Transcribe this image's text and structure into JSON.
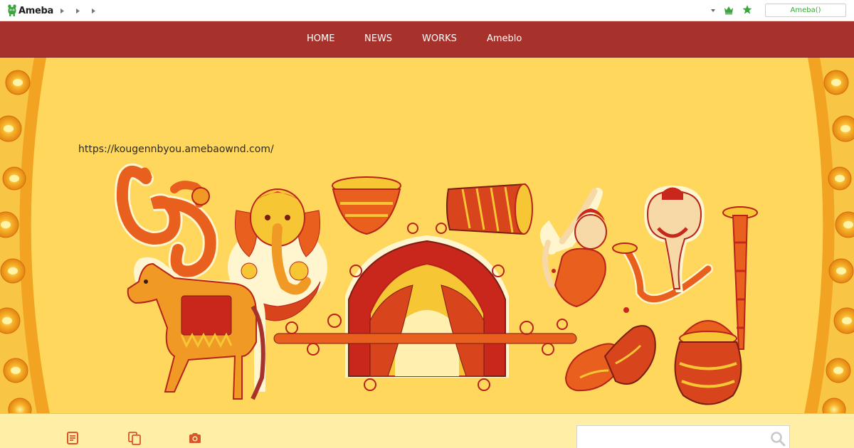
{
  "topbar": {
    "logo_text": "Ameba",
    "login_label": "Ameba()",
    "icons": [
      "ameba-mascot-icon",
      "chevron-right-icon",
      "caret-down-icon",
      "crown-icon",
      "star-icon"
    ]
  },
  "nav": {
    "items": [
      {
        "label": "HOME"
      },
      {
        "label": "NEWS"
      },
      {
        "label": "WORKS"
      },
      {
        "label": "Ameblo"
      }
    ]
  },
  "hero": {
    "url_text": "https://kougennbyou.amebaownd.com/",
    "illustration": "indian-folk-art-illustration"
  },
  "bottom": {
    "icons": [
      "document-icon",
      "pages-icon",
      "camera-icon",
      "search-icon"
    ],
    "search_value": ""
  },
  "colors": {
    "nav_bg": "#a7312b",
    "hero_bg": "#ffd75c",
    "page_bg": "#ffeea6",
    "accent_green": "#3aa53a",
    "icon_red": "#d9552b"
  }
}
